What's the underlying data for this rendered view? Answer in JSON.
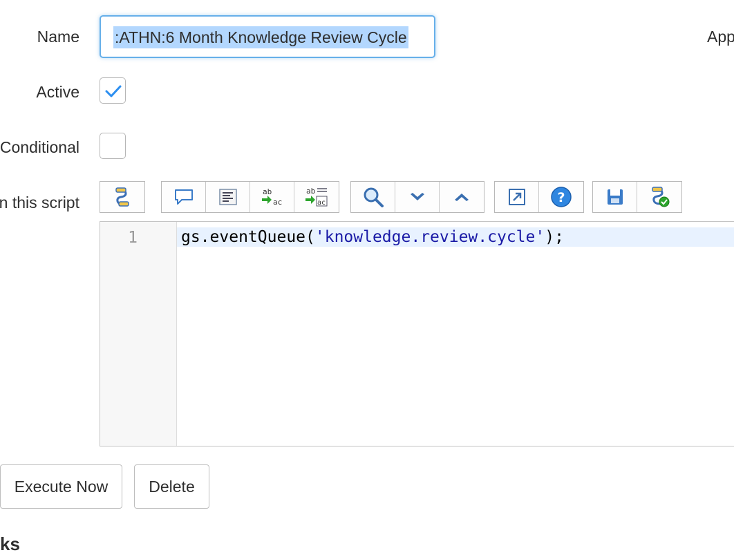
{
  "form": {
    "name_label": "Name",
    "name_value": ":ATHN:6 Month Knowledge Review Cycle",
    "active_label": "Active",
    "active_checked": true,
    "conditional_label": "Conditional",
    "conditional_checked": false,
    "script_label": "n this script",
    "app_label": "App"
  },
  "editor": {
    "line_number": "1",
    "code_prefix": "gs.eventQueue(",
    "code_string": "'knowledge.review.cycle'",
    "code_suffix": ");"
  },
  "toolbar": {
    "groups": [
      [
        "script-tree-icon"
      ],
      [
        "comment-icon",
        "format-code-icon",
        "replace-icon",
        "replace-all-icon"
      ],
      [
        "search-icon",
        "next-icon",
        "previous-icon"
      ],
      [
        "fullscreen-icon",
        "help-icon"
      ],
      [
        "save-icon",
        "check-syntax-icon"
      ]
    ]
  },
  "actions": {
    "execute_label": "Execute Now",
    "delete_label": "Delete"
  },
  "section": {
    "heading_partial": "ks"
  },
  "colors": {
    "focus_border": "#66afe9",
    "selection": "#b3d7fe",
    "checkmark": "#2d8ff0",
    "code_string": "#1a1aa6"
  }
}
